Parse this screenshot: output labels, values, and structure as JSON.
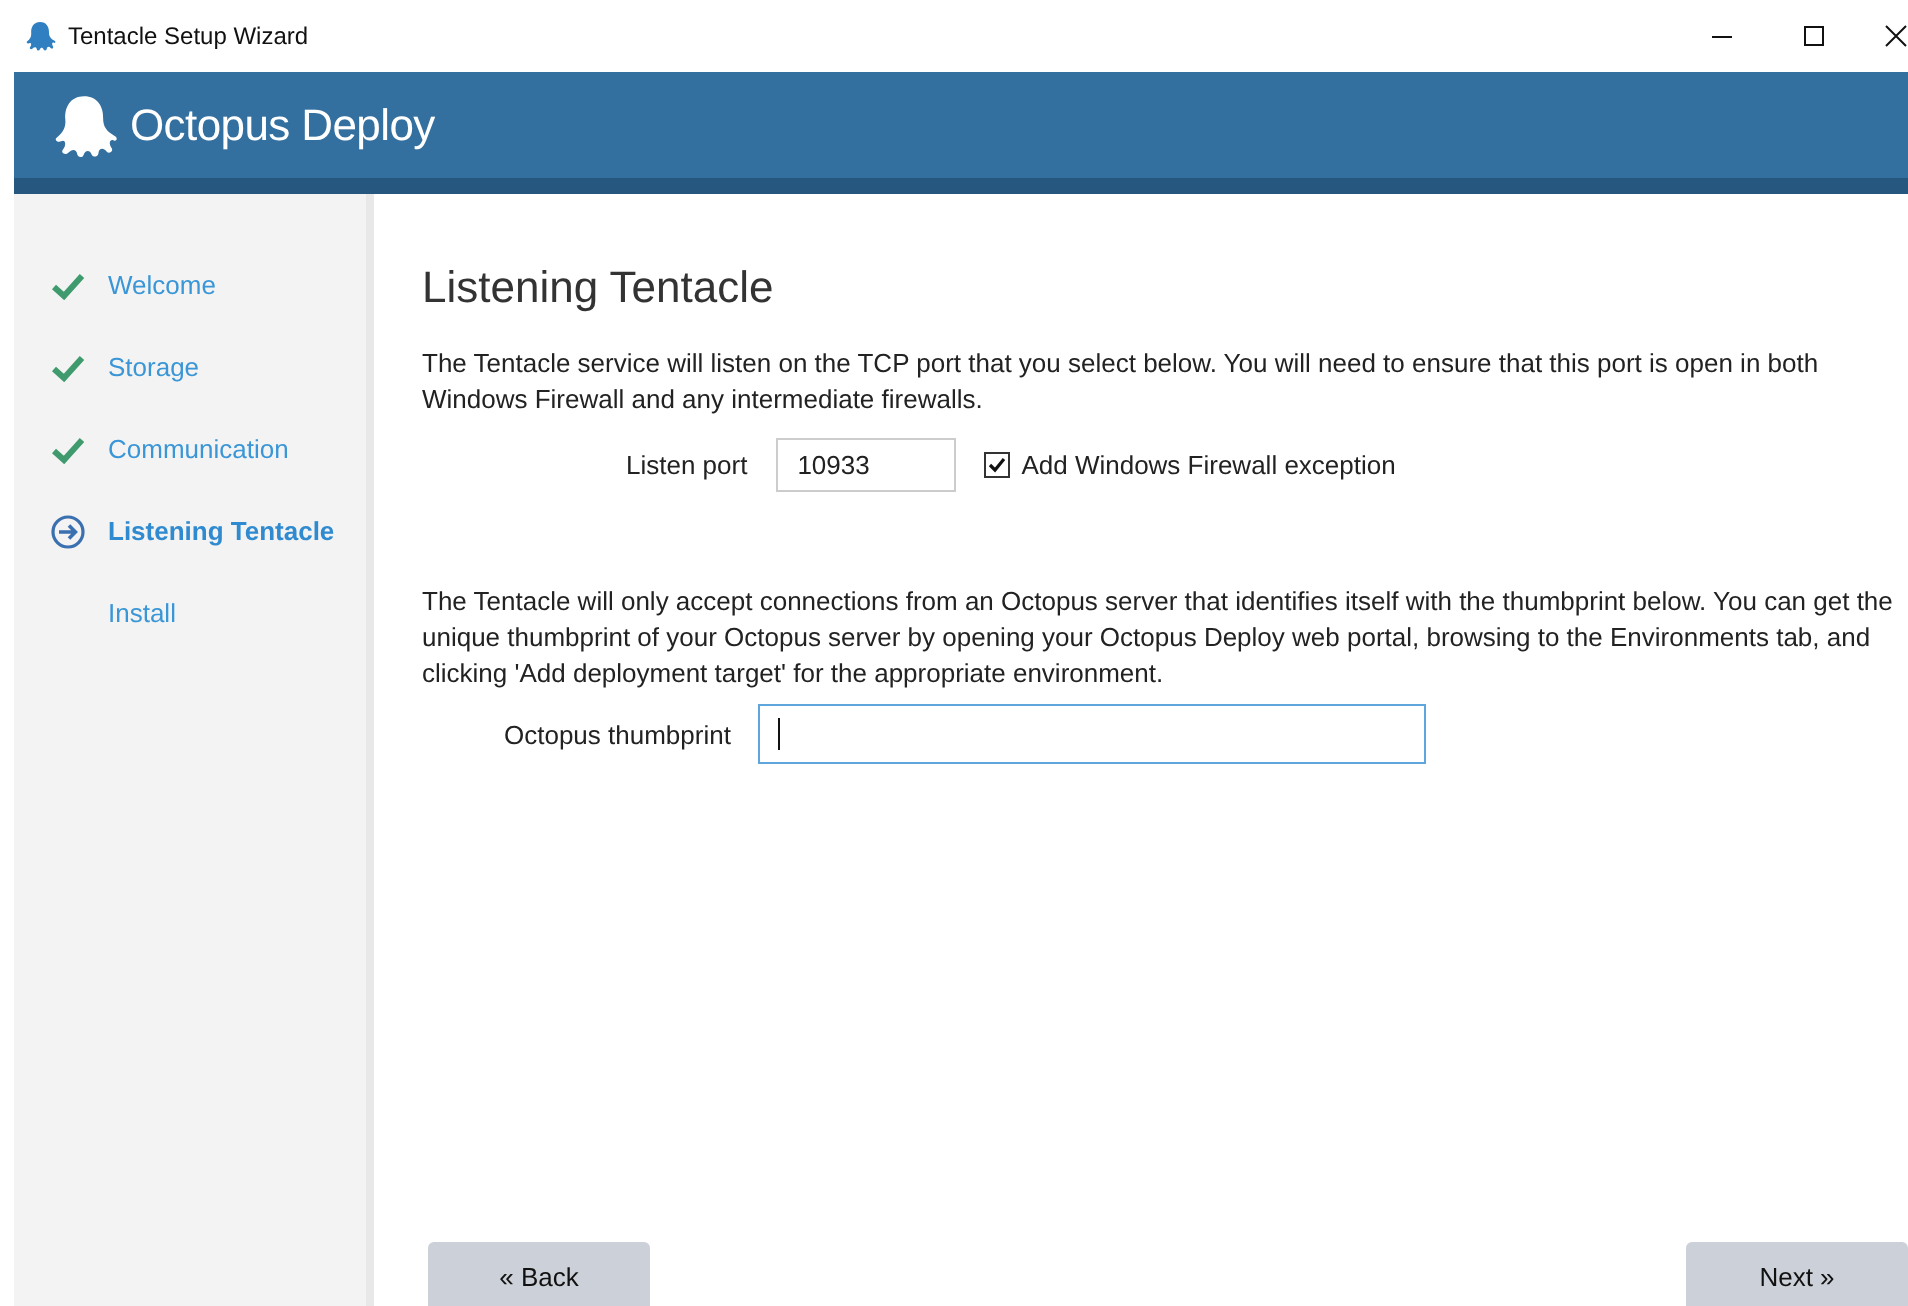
{
  "window": {
    "title": "Tentacle Setup Wizard"
  },
  "header": {
    "product": "Octopus Deploy"
  },
  "steps": [
    {
      "label": "Welcome",
      "kind": "done",
      "selected": false
    },
    {
      "label": "Storage",
      "kind": "done",
      "selected": false
    },
    {
      "label": "Communication",
      "kind": "done",
      "selected": false
    },
    {
      "label": "Listening Tentacle",
      "kind": "current",
      "selected": true
    },
    {
      "label": "Install",
      "kind": "pending",
      "selected": false
    }
  ],
  "page": {
    "heading": "Listening Tentacle",
    "port_intro": "The Tentacle service will listen on the TCP port that you select below. You will need to ensure that this port is open in both Windows Firewall and any intermediate firewalls.",
    "port": {
      "label": "Listen port",
      "value": "10933"
    },
    "firewall": {
      "label": "Add Windows Firewall exception",
      "checked": true
    },
    "thumb_intro": "The Tentacle will only accept connections from an Octopus server that identifies itself with the thumbprint below. You can get the unique thumbprint of your Octopus server by opening your Octopus Deploy web portal, browsing to the Environments tab, and clicking 'Add deployment target' for the appropriate environment.",
    "thumbprint": {
      "label": "Octopus thumbprint",
      "focused": true
    }
  },
  "buttons": {
    "back": "« Back",
    "next": "Next »"
  }
}
